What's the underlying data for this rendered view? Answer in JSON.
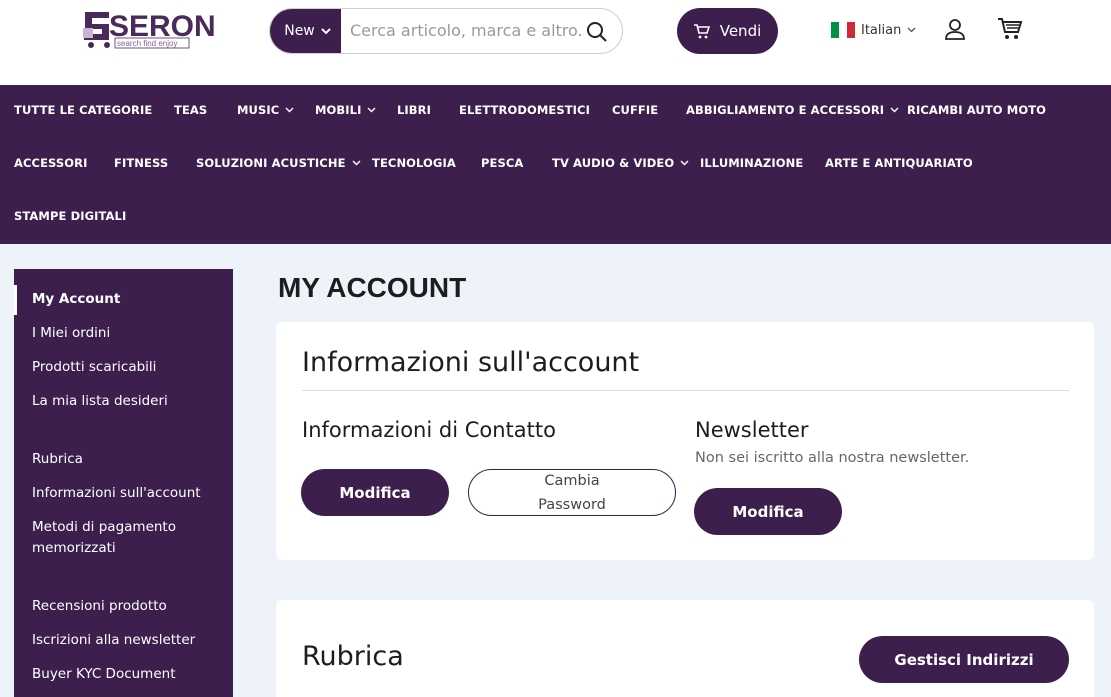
{
  "header": {
    "logo_text": "SERON",
    "logo_tagline": "search find enjoy",
    "search": {
      "scope": "New",
      "placeholder": "Cerca articolo, marca e altro."
    },
    "sell_label": "Vendi",
    "language": "Italian"
  },
  "nav": {
    "items": [
      {
        "label": "TUTTE LE CATEGORIE",
        "dropdown": false
      },
      {
        "label": "TEAS",
        "dropdown": false
      },
      {
        "label": "MUSIC",
        "dropdown": true
      },
      {
        "label": "MOBILI",
        "dropdown": true
      },
      {
        "label": "LIBRI",
        "dropdown": false
      },
      {
        "label": "ELETTRODOMESTICI",
        "dropdown": false
      },
      {
        "label": "CUFFIE",
        "dropdown": false
      },
      {
        "label": "ABBIGLIAMENTO E ACCESSORI",
        "dropdown": true
      },
      {
        "label": "RICAMBI AUTO MOTO",
        "dropdown": false
      },
      {
        "label": "ACCESSORI",
        "dropdown": false
      },
      {
        "label": "FITNESS",
        "dropdown": false
      },
      {
        "label": "SOLUZIONI ACUSTICHE",
        "dropdown": true
      },
      {
        "label": "TECNOLOGIA",
        "dropdown": false
      },
      {
        "label": "PESCA",
        "dropdown": false
      },
      {
        "label": "TV AUDIO & VIDEO",
        "dropdown": true
      },
      {
        "label": "ILLUMINAZIONE",
        "dropdown": false
      },
      {
        "label": "ARTE E ANTIQUARIATO",
        "dropdown": false
      },
      {
        "label": "STAMPE DIGITALI",
        "dropdown": false
      }
    ]
  },
  "sidebar": {
    "items": [
      {
        "label": "My Account",
        "active": true
      },
      {
        "label": "I Miei ordini"
      },
      {
        "label": "Prodotti scaricabili"
      },
      {
        "label": "La mia lista desideri"
      },
      {
        "label": "Rubrica"
      },
      {
        "label": "Informazioni sull'account"
      },
      {
        "label": "Metodi di pagamento memorizzati"
      },
      {
        "label": "Recensioni prodotto"
      },
      {
        "label": "Iscrizioni alla newsletter"
      },
      {
        "label": "Buyer KYC Document"
      }
    ]
  },
  "main": {
    "title": "MY ACCOUNT",
    "account_info": {
      "heading": "Informazioni sull'account",
      "contact": {
        "heading": "Informazioni di Contatto",
        "edit_label": "Modifica",
        "password_label": "Cambia Password"
      },
      "newsletter": {
        "heading": "Newsletter",
        "status": "Non sei iscritto alla nostra newsletter.",
        "edit_label": "Modifica"
      }
    },
    "address_book": {
      "heading": "Rubrica",
      "manage_label": "Gestisci Indirizzi"
    }
  },
  "colors": {
    "brand": "#3d1f4e",
    "page_bg": "#eef3fa"
  }
}
